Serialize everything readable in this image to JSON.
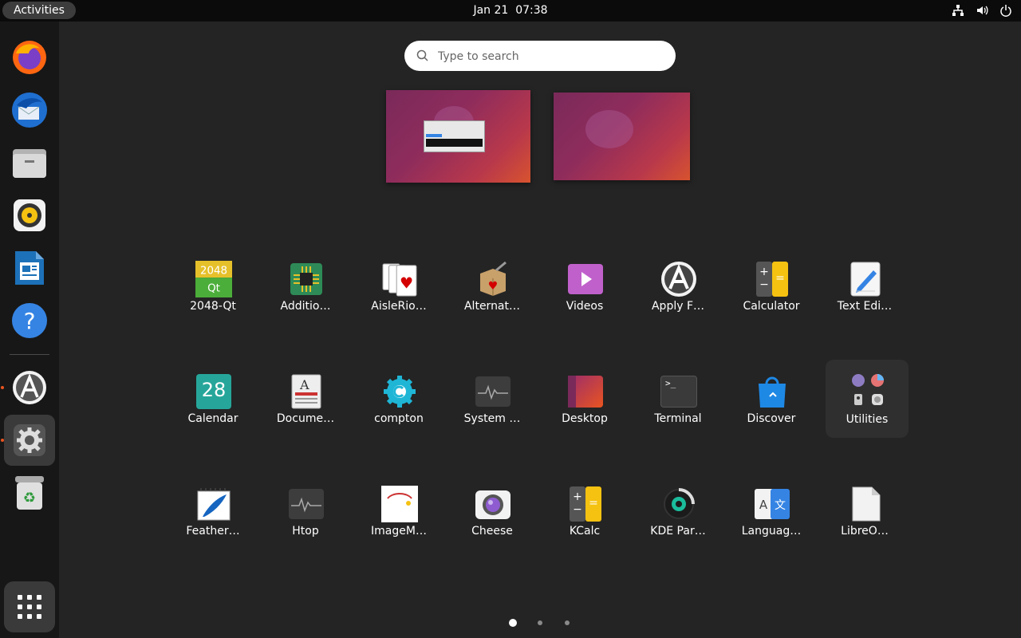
{
  "topbar": {
    "activities_label": "Activities",
    "clock": "Jan 21  07:38",
    "tray_icons": [
      "network-icon",
      "volume-icon",
      "power-icon"
    ]
  },
  "dock": {
    "items": [
      {
        "name": "Firefox",
        "icon": "firefox-icon",
        "running": false
      },
      {
        "name": "Thunderbird",
        "icon": "thunderbird-icon",
        "running": false
      },
      {
        "name": "Files",
        "icon": "files-icon",
        "running": false
      },
      {
        "name": "Rhythmbox",
        "icon": "rhythmbox-icon",
        "running": false
      },
      {
        "name": "LibreOffice Writer",
        "icon": "writer-icon",
        "running": false
      },
      {
        "name": "Help",
        "icon": "help-icon",
        "running": false
      },
      {
        "name": "Software Updater",
        "icon": "software-icon",
        "running": true
      },
      {
        "name": "Settings",
        "icon": "settings-icon",
        "running": true,
        "active": true
      },
      {
        "name": "Trash",
        "icon": "trash-icon",
        "running": false
      }
    ],
    "show_apps_icon": "app-grid-icon"
  },
  "search": {
    "placeholder": "Type to search",
    "value": ""
  },
  "workspaces": {
    "count": 2
  },
  "apps": {
    "row1": [
      {
        "label": "2048-Qt",
        "icon": "2048-icon"
      },
      {
        "label": "Additio…",
        "icon": "chip-icon"
      },
      {
        "label": "AisleRio…",
        "icon": "cards-icon"
      },
      {
        "label": "Alternat…",
        "icon": "box-icon"
      },
      {
        "label": "Videos",
        "icon": "videos-icon"
      },
      {
        "label": "Apply F…",
        "icon": "apply-icon"
      },
      {
        "label": "Calculator",
        "icon": "calculator-icon"
      },
      {
        "label": "Text Edi…",
        "icon": "text-editor-icon"
      }
    ],
    "row2": [
      {
        "label": "Calendar",
        "icon": "calendar-icon",
        "day": "28"
      },
      {
        "label": "Docume…",
        "icon": "document-viewer-icon"
      },
      {
        "label": "compton",
        "icon": "compton-icon"
      },
      {
        "label": "System …",
        "icon": "system-monitor-icon"
      },
      {
        "label": "Desktop",
        "icon": "desktop-icon"
      },
      {
        "label": "Terminal",
        "icon": "terminal-icon",
        "prompt": ">_"
      },
      {
        "label": "Discover",
        "icon": "discover-icon"
      },
      {
        "label": "Utilities",
        "icon": "folder-icon"
      }
    ],
    "row3": [
      {
        "label": "Feather…",
        "icon": "feather-icon"
      },
      {
        "label": "Htop",
        "icon": "htop-icon"
      },
      {
        "label": "ImageM…",
        "icon": "imagemagick-icon"
      },
      {
        "label": "Cheese",
        "icon": "cheese-icon"
      },
      {
        "label": "KCalc",
        "icon": "kcalc-icon"
      },
      {
        "label": "KDE Par…",
        "icon": "partition-icon"
      },
      {
        "label": "Languag…",
        "icon": "language-icon"
      },
      {
        "label": "LibreO…",
        "icon": "libreoffice-icon"
      }
    ]
  },
  "pagination": {
    "pages": 3,
    "current": 1
  },
  "colors": {
    "accent": "#e95420",
    "background": "#242424",
    "dock": "#171717",
    "topbar": "#0b0b0b"
  }
}
